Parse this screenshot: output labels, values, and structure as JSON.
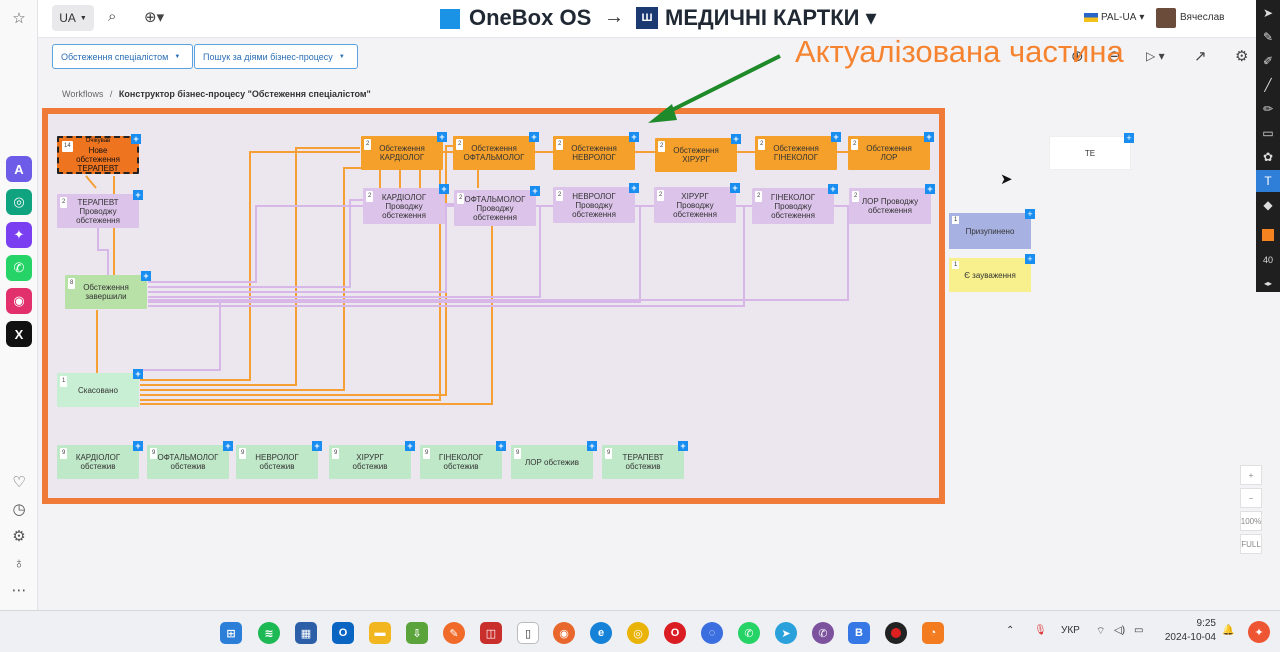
{
  "topbar": {
    "lang": "UA",
    "brand": "OneBox OS",
    "arrow": "→",
    "project": "МЕДИЧНІ КАРТКИ",
    "env": "PAL-UA",
    "user": "Вячеслав"
  },
  "toolbar": {
    "dropdown1": "Обстеження спеціалістом",
    "dropdown2": "Пошук за діями бізнес-процесу"
  },
  "breadcrumb": {
    "root": "Workflows",
    "separator": "/",
    "current": "Конструктор бізнес-процесу \"Обстеження спеціалістом\""
  },
  "annotation": "Актуалізована частина",
  "nodes": {
    "start": {
      "badge": "14",
      "small": "Очікував",
      "label": "Нове обстеження ТЕРАПЕВТ"
    },
    "therapist_doing": {
      "badge": "2",
      "label": "ТЕРАПЕВТ Проводжу обстеження"
    },
    "finished": {
      "badge": "8",
      "label": "Обстеження завершили"
    },
    "cancelled": {
      "badge": "1",
      "label": "Скасовано"
    },
    "top_row": [
      {
        "badge": "2",
        "label": "Обстеження КАРДІОЛОГ"
      },
      {
        "badge": "2",
        "label": "Обстеження ОФТАЛЬМОЛОГ"
      },
      {
        "badge": "2",
        "label": "Обстеження НЕВРОЛОГ"
      },
      {
        "badge": "2",
        "label": "Обстеження ХІРУРГ"
      },
      {
        "badge": "2",
        "label": "Обстеження ГІНЕКОЛОГ"
      },
      {
        "badge": "2",
        "label": "Обстеження ЛОР"
      }
    ],
    "second_row": [
      {
        "badge": "2",
        "label": "КАРДІОЛОГ Проводжу обстеження"
      },
      {
        "badge": "2",
        "label": "ОФТАЛЬМОЛОГ Проводжу обстеження"
      },
      {
        "badge": "2",
        "label": "НЕВРОЛОГ Проводжу обстеження"
      },
      {
        "badge": "2",
        "label": "ХІРУРГ Проводжу обстеження"
      },
      {
        "badge": "2",
        "label": "ГІНЕКОЛОГ Проводжу обстеження"
      },
      {
        "badge": "2",
        "label": "ЛОР Проводжу обстеження"
      }
    ],
    "bottom_row": [
      {
        "badge": "9",
        "label": "КАРДІОЛОГ обстежив"
      },
      {
        "badge": "9",
        "label": "ОФТАЛЬМОЛОГ обстежив"
      },
      {
        "badge": "9",
        "label": "НЕВРОЛОГ обстежив"
      },
      {
        "badge": "9",
        "label": "ХІРУРГ обстежив"
      },
      {
        "badge": "9",
        "label": "ГІНЕКОЛОГ обстежив"
      },
      {
        "badge": "9",
        "label": "ЛОР обстежив"
      },
      {
        "badge": "9",
        "label": "ТЕРАПЕВТ обстежив"
      }
    ]
  },
  "side": {
    "te": "ТЕ",
    "paused_badge": "1",
    "paused": "Призупинено",
    "remarks_badge": "1",
    "remarks": "Є зауваження"
  },
  "zoom": {
    "pct": "100%",
    "full": "FULL",
    "plus": "+",
    "minus": "−"
  },
  "drawbar": {
    "size": "40"
  },
  "tray": {
    "lang": "УКР",
    "time": "9:25",
    "date": "2024-10-04"
  },
  "colors": {
    "accent": "#1a93e6",
    "frame": "#f07a38",
    "annotation": "#f58330",
    "arrow": "#1e8a2a"
  }
}
